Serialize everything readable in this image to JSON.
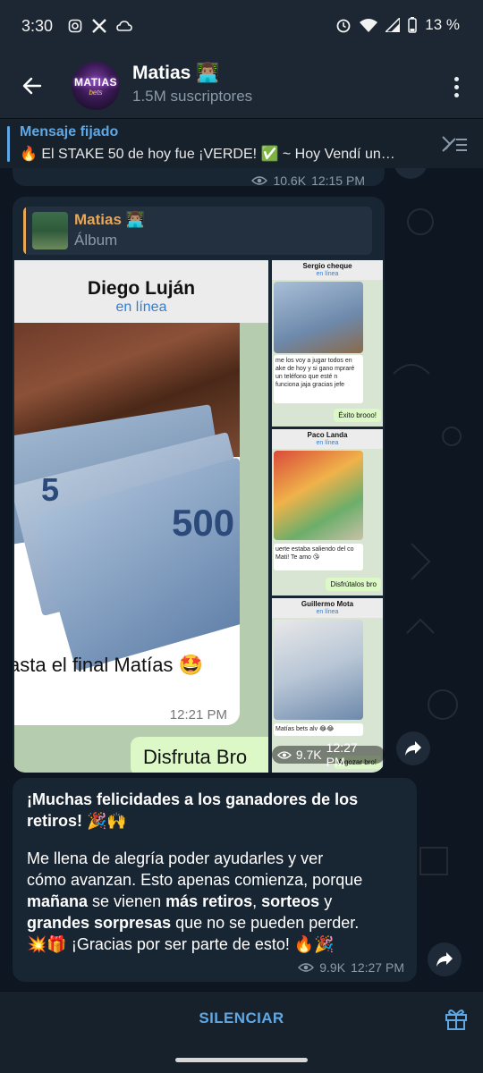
{
  "status_bar": {
    "time": "3:30",
    "battery": "13 %"
  },
  "header": {
    "channel_name": "Matias 👨🏽‍💻",
    "subscribers": "1.5M suscriptores",
    "avatar_text": "MATIAS",
    "avatar_sub": "bets"
  },
  "pinned": {
    "title": "Mensaje fijado",
    "text": "🔥 El STAKE 50 de hoy fue ¡VERDE! ✅ ~ Hoy Vendí un…"
  },
  "previous_message": {
    "views": "10.6K",
    "time": "12:15 PM"
  },
  "album": {
    "reply_name": "Matias 👨🏽‍💻",
    "reply_sub": "Álbum",
    "views": "9.7K",
    "time": "12:27 PM",
    "photo_main": {
      "contact": "Diego Luján",
      "status": "en línea",
      "denomination": "500",
      "denomination_small": "5",
      "caption": "asta el final Matías 🤩",
      "time": "12:21 PM",
      "reply": "Disfruta Bro"
    },
    "photo_side": [
      {
        "contact": "Sergio cheque",
        "status": "en línea",
        "text": "me los voy a jugar todos en ake de hoy y si gano mpraré un teléfono que esté n funciona jaja gracias jefe",
        "reply": "Éxito brooo!"
      },
      {
        "contact": "Paco Landa",
        "status": "en línea",
        "text": "uerte estaba saliendo del co Mati! Te amo 😘",
        "reply": "Disfrútalos bro"
      },
      {
        "contact": "Guillermo Mota",
        "status": "en línea",
        "text": "Matías bets alv 😂😂",
        "reply": "A gozar bro!"
      }
    ]
  },
  "text_message": {
    "line1": "¡Muchas felicidades a los ganadores de los",
    "line2": "retiros! 🎉🙌",
    "p2_line1": "Me llena de alegría poder ayudarles y ver",
    "p2_line2": "cómo avanzan. Esto apenas comienza, porque",
    "p2_line3_a": "mañana",
    "p2_line3_b": " se vienen ",
    "p2_line3_c": "más retiros",
    "p2_line3_d": ", ",
    "p2_line3_e": "sorteos",
    "p2_line3_f": " y",
    "p2_line4_a": "grandes sorpresas",
    "p2_line4_b": " que no se pueden perder.",
    "p2_line5": "💥🎁 ¡Gracias por ser parte de esto! 🔥🎉",
    "views": "9.9K",
    "time": "12:27 PM"
  },
  "bottom": {
    "mute_label": "SILENCIAR"
  },
  "colors": {
    "accent": "#5fa8e6",
    "bubble": "#182533",
    "background": "#0e1621",
    "reply_name": "#e9a755"
  },
  "icons": [
    "back-arrow-icon",
    "more-vert-icon",
    "unpin-icon",
    "eye-icon",
    "forward-icon",
    "gift-icon",
    "wifi-icon",
    "signal-icon",
    "battery-icon",
    "alarm-icon"
  ]
}
